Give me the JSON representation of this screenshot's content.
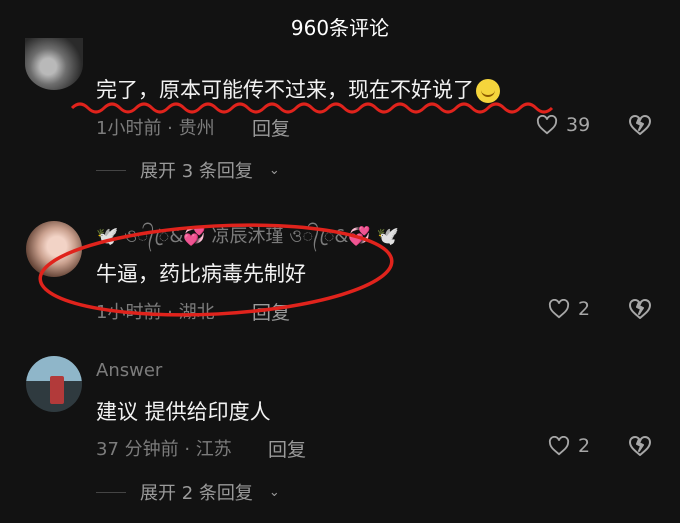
{
  "header": {
    "title": "960条评论"
  },
  "comments": [
    {
      "text": "完了，原本可能传不过来，现在不好说了",
      "time_location": "1小时前 · 贵州",
      "reply_label": "回复",
      "likes": "39",
      "expand_label": "展开 3 条回复"
    },
    {
      "username": "🕊️ ও᭄ꦿ&💞 凉辰沐瑾 ও᭄ꦿ&💞 🕊️",
      "text": "牛逼，药比病毒先制好",
      "time_location": "1小时前 · 湖北",
      "reply_label": "回复",
      "likes": "2"
    },
    {
      "username": "Answer",
      "text": "建议 提供给印度人",
      "time_location": "37 分钟前 · 江苏",
      "reply_label": "回复",
      "likes": "2",
      "expand_label": "展开 2 条回复"
    }
  ],
  "colors": {
    "annotation_red": "#e0231c",
    "background": "#121212"
  },
  "icons": {
    "like": "heart-outline-icon",
    "dislike": "broken-heart-icon",
    "expand": "chevron-down-icon",
    "emoji": "smiley-face-icon"
  }
}
